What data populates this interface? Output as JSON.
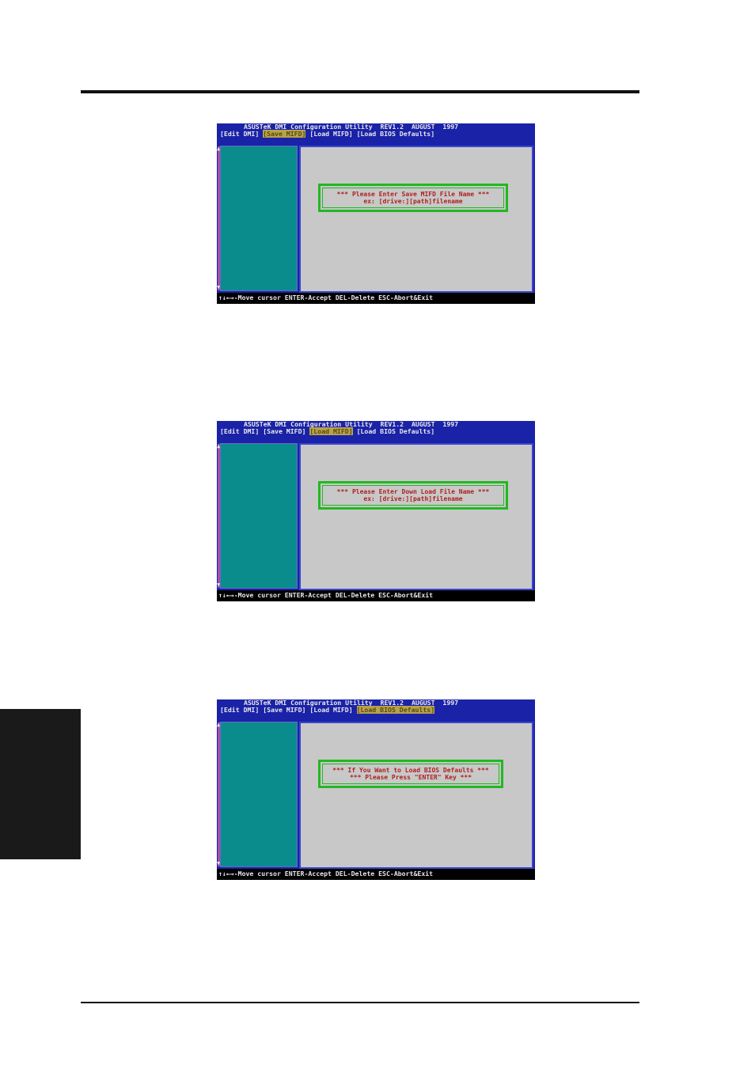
{
  "screens": [
    {
      "title": "ASUSTeK DMI Configuration Utility  REV1.2  AUGUST  1997",
      "menu": [
        "[Edit DMI]",
        "[Save MIFD]",
        "[Load MIFD]",
        "[Load BIOS Defaults]"
      ],
      "active_index": 1,
      "dialog": [
        "*** Please Enter Save MIFD File Name ***",
        "ex: [drive:][path]filename"
      ],
      "footer": "↑↓←→-Move cursor ENTER-Accept DEL-Delete ESC-Abort&Exit"
    },
    {
      "title": "ASUSTeK DMI Configuration Utility  REV1.2  AUGUST  1997",
      "menu": [
        "[Edit DMI]",
        "[Save MIFD]",
        "[Load MIFD]",
        "[Load BIOS Defaults]"
      ],
      "active_index": 2,
      "dialog": [
        "*** Please Enter Down Load File Name ***",
        "ex: [drive:][path]filename"
      ],
      "footer": "↑↓←→-Move cursor ENTER-Accept DEL-Delete ESC-Abort&Exit"
    },
    {
      "title": "ASUSTeK DMI Configuration Utility  REV1.2  AUGUST  1997",
      "menu": [
        "[Edit DMI]",
        "[Save MIFD]",
        "[Load MIFD]",
        "[Load BIOS Defaults]"
      ],
      "active_index": 3,
      "dialog": [
        "*** If You Want to Load BIOS Defaults ***",
        "*** Please Press \"ENTER\" Key ***"
      ],
      "footer": "↑↓←→-Move cursor ENTER-Accept DEL-Delete ESC-Abort&Exit"
    }
  ],
  "colors": {
    "header_bg": "#1a22a8",
    "left_panel": "#0b8c8c",
    "right_panel": "#c8c8c8",
    "dialog_border": "#22b822",
    "dialog_text": "#b02020",
    "menu_highlight": "#b8a24a"
  }
}
